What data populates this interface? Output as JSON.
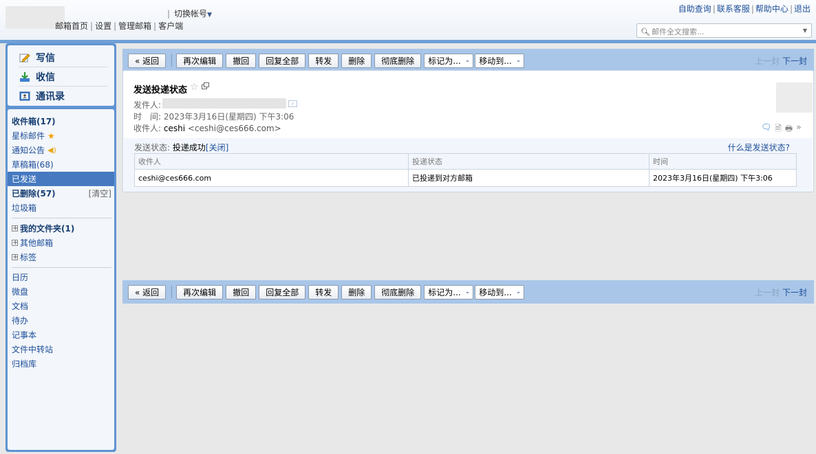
{
  "header": {
    "switch_account": "切换帐号",
    "nav": [
      "邮箱首页",
      "设置",
      "管理邮箱",
      "客户端"
    ],
    "right_links": [
      "自助查询",
      "联系客服",
      "帮助中心",
      "退出"
    ],
    "search_placeholder": "邮件全文搜索..."
  },
  "sidebar": {
    "compose": "写信",
    "receive": "收信",
    "contacts": "通讯录",
    "inbox": "收件箱(17)",
    "starred": "星标邮件",
    "notice": "通知公告",
    "drafts": "草稿箱(68)",
    "sent": "已发送",
    "deleted": "已删除(57)",
    "clear": "[清空]",
    "trash": "垃圾箱",
    "my_folders": "我的文件夹(1)",
    "other_mailboxes": "其他邮箱",
    "tags": "标签",
    "apps": [
      "日历",
      "微盘",
      "文档",
      "待办",
      "记事本",
      "文件中转站",
      "归档库"
    ]
  },
  "toolbar": {
    "back": "« 返回",
    "reedit": "再次编辑",
    "recall": "撤回",
    "reply_all": "回复全部",
    "forward": "转发",
    "delete": "删除",
    "delete_forever": "彻底删除",
    "mark_as": "标记为...",
    "move_to": "移动到...",
    "prev": "上一封",
    "next": "下一封"
  },
  "mail": {
    "subject": "发送投递状态",
    "sender_label": "发件人:",
    "time_label": "时　间:",
    "time_value": "2023年3月16日(星期四) 下午3:06",
    "recipient_label": "收件人:",
    "recipient_name": "ceshi",
    "recipient_email": "<ceshi@ces666.com>"
  },
  "delivery": {
    "status_label": "发送状态:",
    "status_value": "投递成功",
    "close_link": "[关闭]",
    "help_link": "什么是发送状态?",
    "columns": [
      "收件人",
      "投递状态",
      "时间"
    ],
    "rows": [
      [
        "ceshi@ces666.com",
        "已投递到对方邮箱",
        "2023年3月16日(星期四) 下午3:06"
      ]
    ]
  },
  "colors": {
    "accent": "#4679c0",
    "toolbar_bg": "#a9c6e8",
    "link": "#1e4f9a"
  }
}
